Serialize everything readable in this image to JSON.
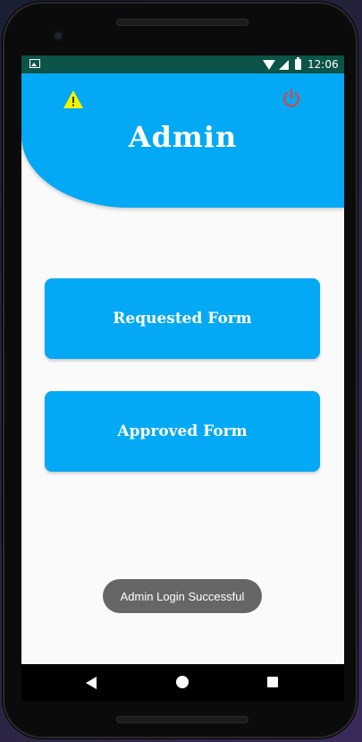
{
  "status_bar": {
    "time": "12:06",
    "icons": [
      "notification-icon",
      "wifi-icon",
      "signal-icon",
      "battery-icon"
    ]
  },
  "header": {
    "title": "Admin",
    "left_icon": "warning-icon",
    "right_icon": "power-icon"
  },
  "buttons": {
    "requested_label": "Requested Form",
    "approved_label": "Approved Form"
  },
  "toast": {
    "message": "Admin Login Successful"
  },
  "nav": {
    "icons": [
      "back-icon",
      "home-icon",
      "recents-icon"
    ]
  },
  "colors": {
    "accent": "#03a9f4",
    "status_bar": "#0b5447",
    "warning": "#f5f500",
    "power": "#e0443a",
    "toast_bg": "#666666"
  }
}
